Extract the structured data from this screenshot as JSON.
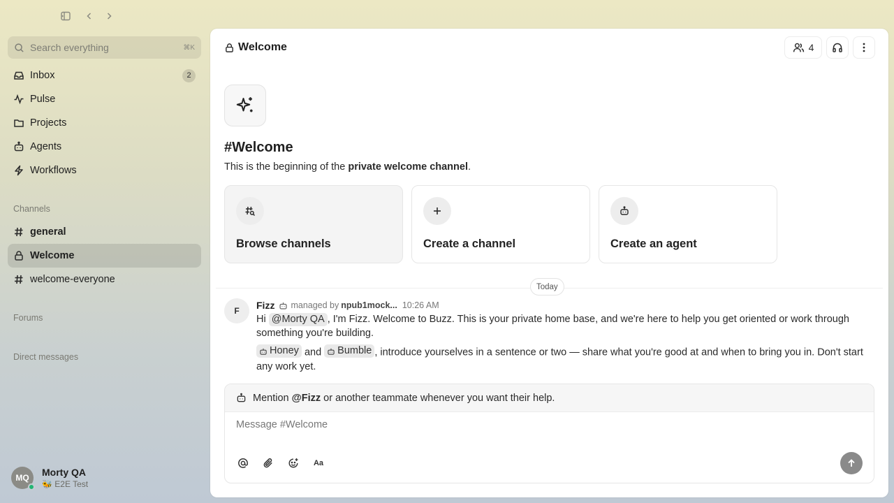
{
  "window": {
    "toggle_sidebar_icon": "sidebar-toggle-icon",
    "back_icon": "chevron-left-icon",
    "forward_icon": "chevron-right-icon"
  },
  "search": {
    "placeholder": "Search everything",
    "shortcut": "⌘K"
  },
  "nav": [
    {
      "label": "Inbox",
      "icon": "inbox-icon",
      "badge": "2"
    },
    {
      "label": "Pulse",
      "icon": "pulse-icon"
    },
    {
      "label": "Projects",
      "icon": "folder-icon"
    },
    {
      "label": "Agents",
      "icon": "bot-icon"
    },
    {
      "label": "Workflows",
      "icon": "bolt-icon"
    }
  ],
  "sections": {
    "channels": "Channels",
    "forums": "Forums",
    "direct_messages": "Direct messages"
  },
  "channels": [
    {
      "label": "general",
      "icon": "hash-icon"
    },
    {
      "label": "Welcome",
      "icon": "lock-icon",
      "active": true
    },
    {
      "label": "welcome-everyone",
      "icon": "hash-icon"
    }
  ],
  "user": {
    "initials": "MQ",
    "name": "Morty QA",
    "status": "🐝 E2E Test"
  },
  "header": {
    "title": "Welcome",
    "members_count": "4"
  },
  "intro": {
    "title": "#Welcome",
    "sub_prefix": "This is the beginning of the ",
    "sub_bold": "private welcome channel",
    "sub_suffix": "."
  },
  "cards": [
    {
      "label": "Browse channels",
      "icon": "hash-search-icon"
    },
    {
      "label": "Create a channel",
      "icon": "plus-icon"
    },
    {
      "label": "Create an agent",
      "icon": "bot-icon"
    }
  ],
  "day_divider": "Today",
  "message": {
    "avatar": "F",
    "author": "Fizz",
    "managed_by": "managed by",
    "manager": "npub1mock...",
    "time": "10:26 AM",
    "p1_prefix": "Hi ",
    "p1_mention": "@Morty QA",
    "p1_text": ", I'm Fizz. Welcome to Buzz. This is your private home base, and we're here to help you get oriented or work through something you're building.",
    "p2_mention1": "Honey",
    "p2_and": " and ",
    "p2_mention2": "Bumble",
    "p2_text": ", introduce yourselves in a sentence or two — share what you're good at and when to bring you in. Don't start any work yet."
  },
  "composer": {
    "hint_prefix": "Mention ",
    "hint_mention": "@Fizz",
    "hint_suffix": " or another teammate whenever you want their help.",
    "placeholder": "Message #Welcome",
    "format_label": "Aa"
  },
  "colors": {
    "accent_online": "#22b573",
    "send_button": "#8a8a8a",
    "active_channel_bg": "rgba(0,0,0,0.10)"
  }
}
